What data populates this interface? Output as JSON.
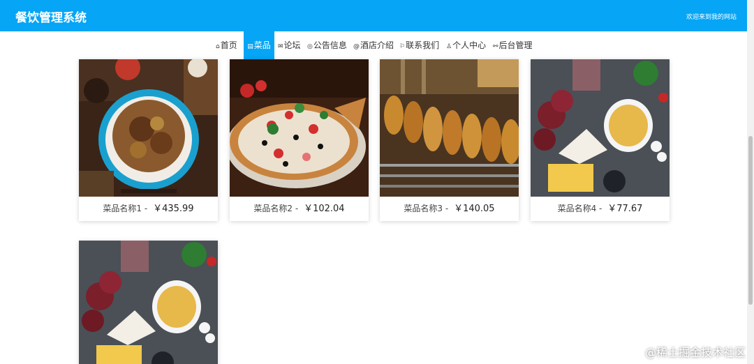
{
  "header": {
    "title": "餐饮管理系统",
    "welcome": "欢迎来到我的网站"
  },
  "nav": [
    {
      "icon": "home-icon",
      "glyph": "⌂",
      "label": "首页",
      "active": false
    },
    {
      "icon": "dish-icon",
      "glyph": "▤",
      "label": "菜品",
      "active": true
    },
    {
      "icon": "forum-icon",
      "glyph": "✉",
      "label": "论坛",
      "active": false
    },
    {
      "icon": "notice-icon",
      "glyph": "◎",
      "label": "公告信息",
      "active": false
    },
    {
      "icon": "hotel-icon",
      "glyph": "@",
      "label": "酒店介绍",
      "active": false
    },
    {
      "icon": "flag-icon",
      "glyph": "⚐",
      "label": "联系我们",
      "active": false
    },
    {
      "icon": "user-icon",
      "glyph": "♙",
      "label": "个人中心",
      "active": false
    },
    {
      "icon": "link-icon",
      "glyph": "⚯",
      "label": "后台管理",
      "active": false
    }
  ],
  "dishes": [
    {
      "name": "菜品名称1",
      "separator": "-",
      "price": "￥435.99",
      "image": "noodles-photo"
    },
    {
      "name": "菜品名称2",
      "separator": "-",
      "price": "￥102.04",
      "image": "pizza-photo"
    },
    {
      "name": "菜品名称3",
      "separator": "-",
      "price": "￥140.05",
      "image": "grill-photo"
    },
    {
      "name": "菜品名称4",
      "separator": "-",
      "price": "￥77.67",
      "image": "cheese-platter-photo"
    },
    {
      "name": "",
      "separator": "",
      "price": "",
      "image": "cheese-platter-photo"
    }
  ],
  "watermark": "@稀土掘金技术社区"
}
